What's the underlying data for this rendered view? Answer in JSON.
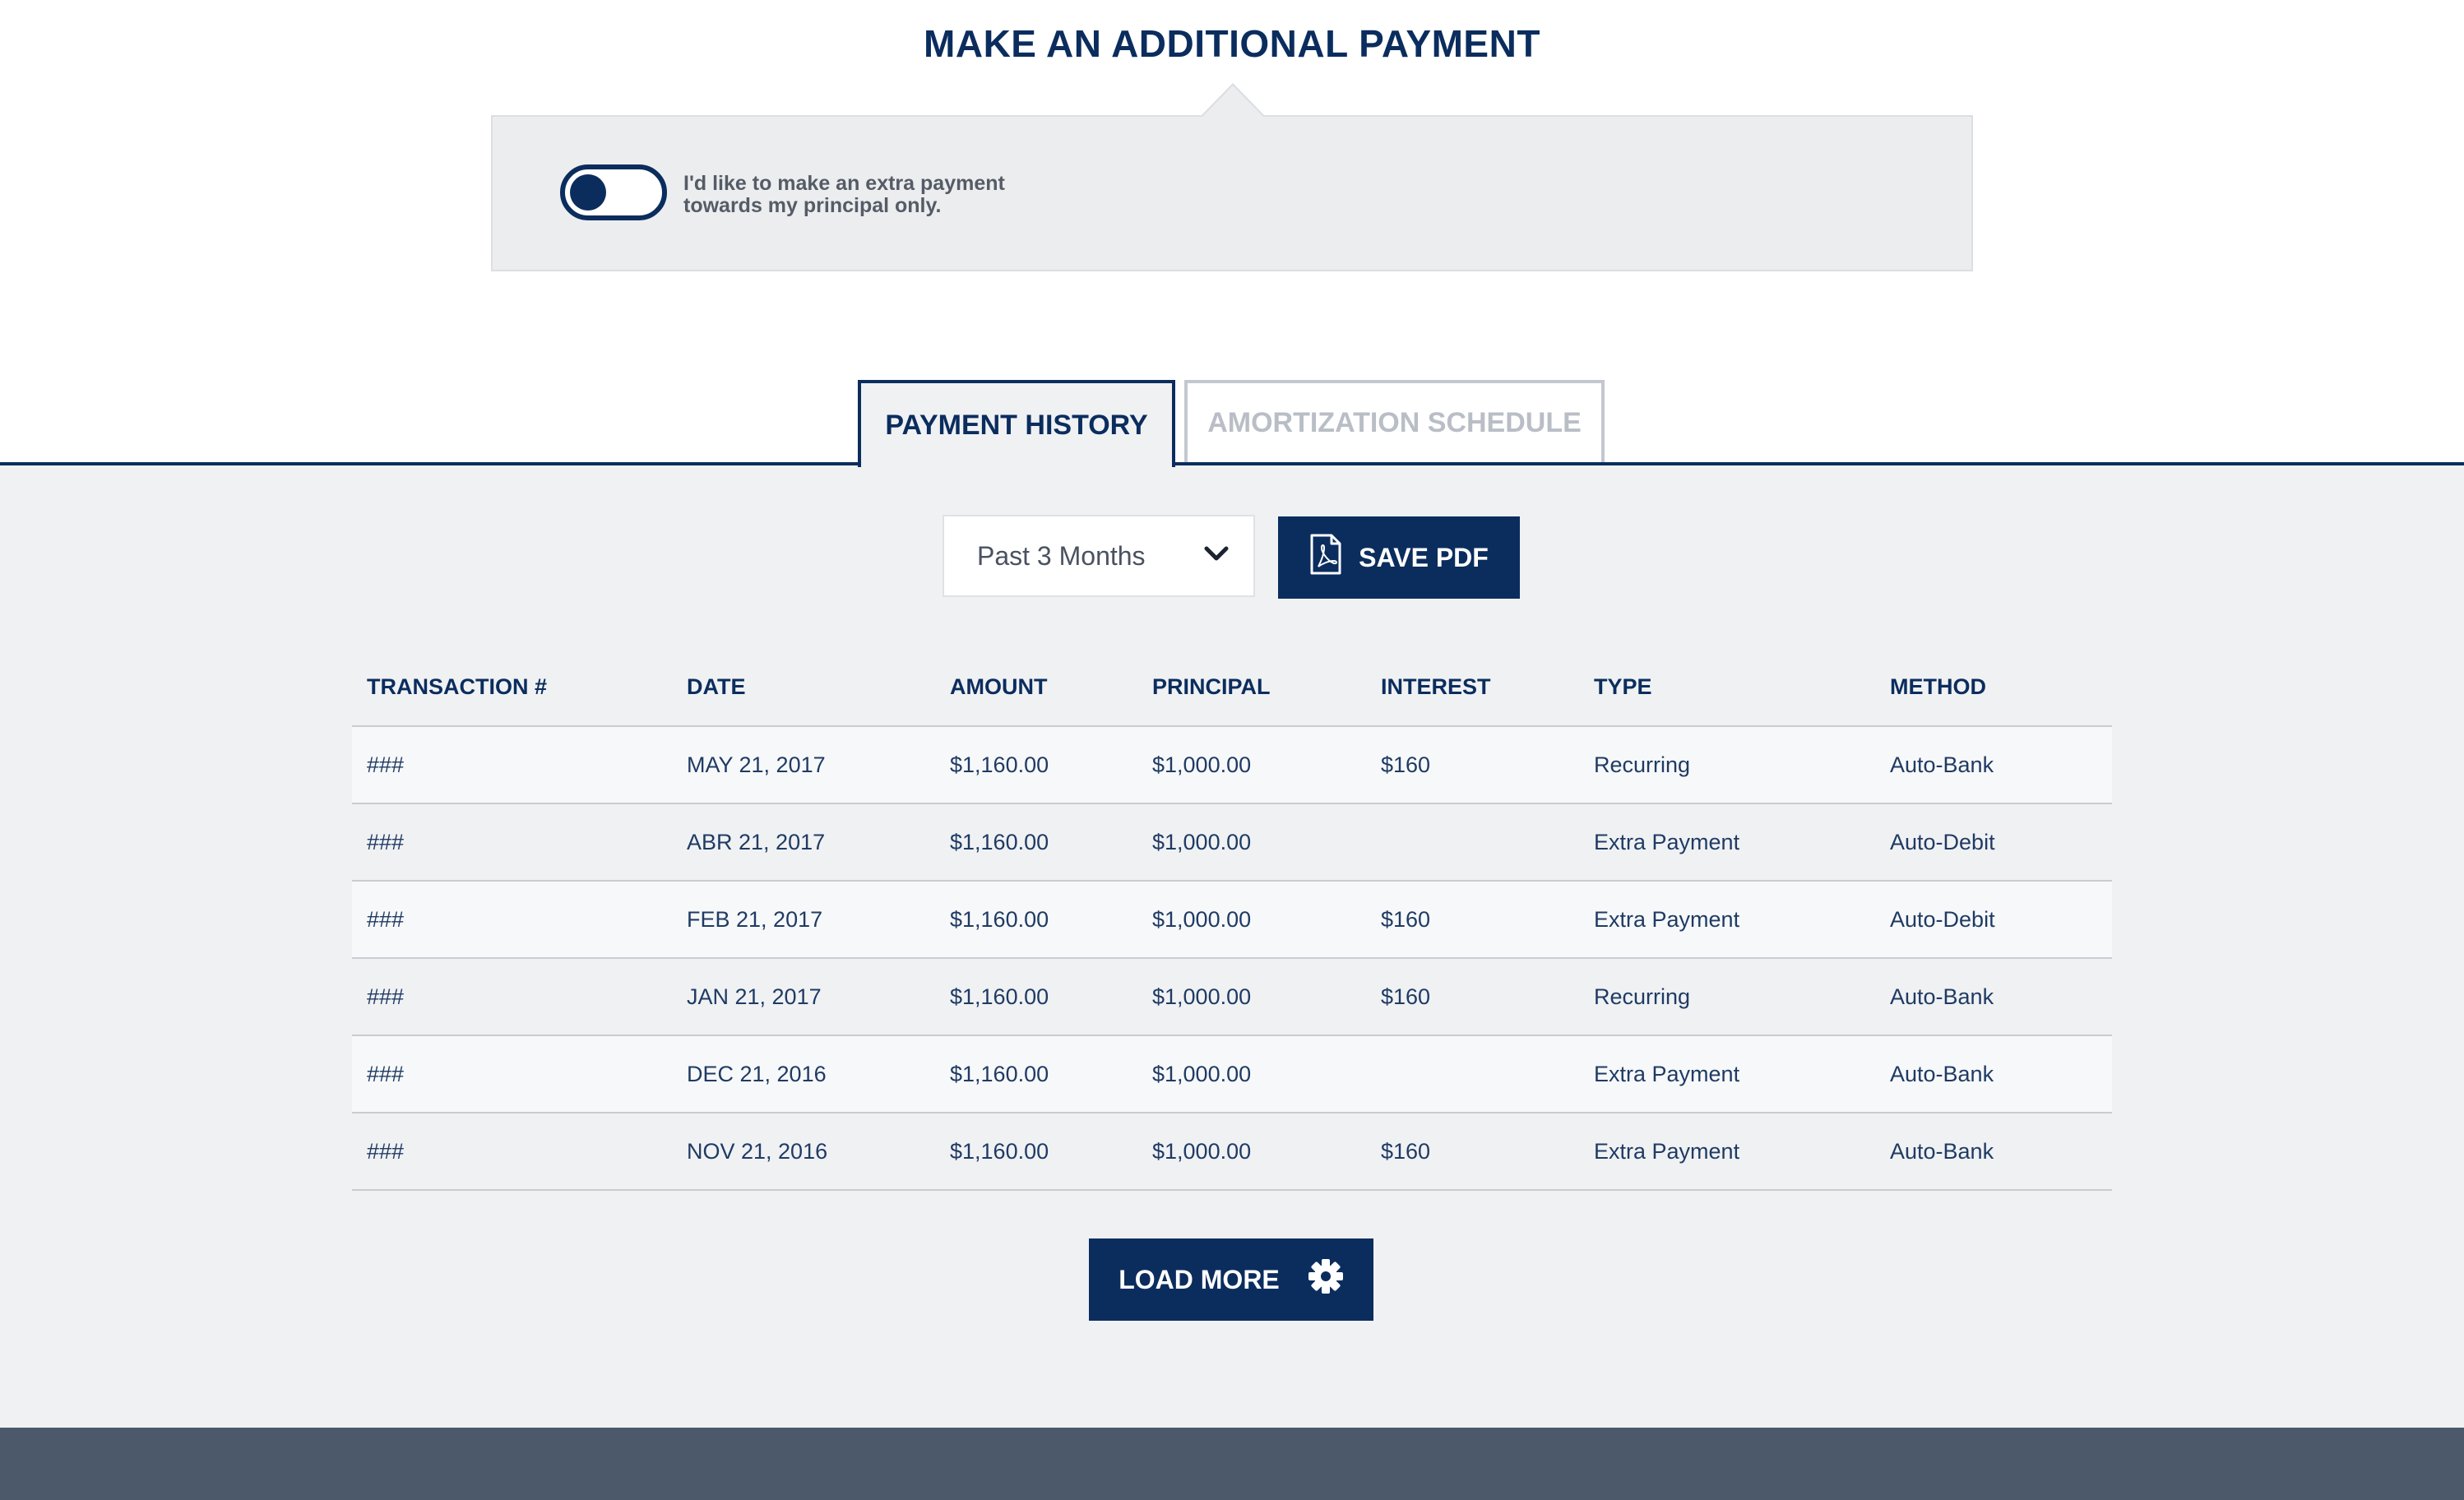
{
  "extra_payment": {
    "title": "MAKE AN ADDITIONAL PAYMENT",
    "toggle_label_line1": "I'd like to make an extra payment",
    "toggle_label_line2": "towards my principal only."
  },
  "tabs": [
    {
      "label": "PAYMENT HISTORY",
      "active": true
    },
    {
      "label": "AMORTIZATION SCHEDULE",
      "active": false
    }
  ],
  "controls": {
    "range_value": "Past 3 Months",
    "save_pdf_label": "SAVE PDF",
    "load_more_label": "LOAD MORE"
  },
  "table": {
    "headers": [
      "TRANSACTION #",
      "DATE",
      "AMOUNT",
      "PRINCIPAL",
      "INTEREST",
      "TYPE",
      "METHOD"
    ],
    "rows": [
      [
        "###",
        "MAY 21, 2017",
        "$1,160.00",
        "$1,000.00",
        "$160",
        "Recurring",
        "Auto-Bank"
      ],
      [
        "###",
        "ABR 21, 2017",
        "$1,160.00",
        "$1,000.00",
        "",
        "Extra Payment",
        "Auto-Debit"
      ],
      [
        "###",
        "FEB 21, 2017",
        "$1,160.00",
        "$1,000.00",
        "$160",
        "Extra Payment",
        "Auto-Debit"
      ],
      [
        "###",
        "JAN 21, 2017",
        "$1,160.00",
        "$1,000.00",
        "$160",
        "Recurring",
        "Auto-Bank"
      ],
      [
        "###",
        "DEC 21, 2016",
        "$1,160.00",
        "$1,000.00",
        "",
        "Extra Payment",
        "Auto-Bank"
      ],
      [
        "###",
        "NOV 21, 2016",
        "$1,160.00",
        "$1,000.00",
        "$160",
        "Extra Payment",
        "Auto-Bank"
      ]
    ]
  },
  "colors": {
    "brand_navy": "#0b2d5e",
    "panel_bg": "#f0f1f3",
    "footer_bg": "#4b596b"
  },
  "icons": {
    "toggle": "toggle-switch-off",
    "select": "chevron-down-icon",
    "save": "pdf-file-icon",
    "load": "gear-icon"
  }
}
